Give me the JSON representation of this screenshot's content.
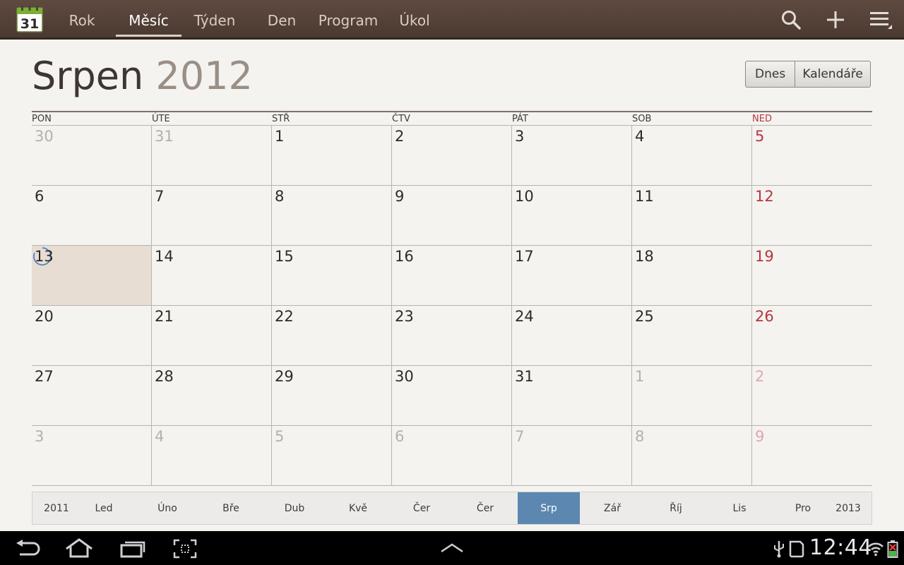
{
  "app": {
    "icon_day": "31",
    "tabs": [
      {
        "label": "Rok",
        "active": false
      },
      {
        "label": "Měsíc",
        "active": true
      },
      {
        "label": "Týden",
        "active": false
      },
      {
        "label": "Den",
        "active": false
      },
      {
        "label": "Program",
        "active": false
      },
      {
        "label": "Úkol",
        "active": false
      }
    ],
    "toolbar_icons": [
      "search-icon",
      "add-icon",
      "menu-icon"
    ]
  },
  "header": {
    "month": "Srpen",
    "year": "2012",
    "today_button": "Dnes",
    "calendars_button": "Kalendáře"
  },
  "weekdays": [
    "PON",
    "ÚTE",
    "STŘ",
    "ČTV",
    "PÁT",
    "SOB",
    "NED"
  ],
  "weeks": [
    [
      {
        "d": "30",
        "o": true
      },
      {
        "d": "31",
        "o": true
      },
      {
        "d": "1"
      },
      {
        "d": "2"
      },
      {
        "d": "3"
      },
      {
        "d": "4"
      },
      {
        "d": "5"
      }
    ],
    [
      {
        "d": "6"
      },
      {
        "d": "7"
      },
      {
        "d": "8"
      },
      {
        "d": "9"
      },
      {
        "d": "10"
      },
      {
        "d": "11"
      },
      {
        "d": "12"
      }
    ],
    [
      {
        "d": "13",
        "today": true
      },
      {
        "d": "14"
      },
      {
        "d": "15"
      },
      {
        "d": "16"
      },
      {
        "d": "17"
      },
      {
        "d": "18"
      },
      {
        "d": "19"
      }
    ],
    [
      {
        "d": "20"
      },
      {
        "d": "21"
      },
      {
        "d": "22"
      },
      {
        "d": "23"
      },
      {
        "d": "24"
      },
      {
        "d": "25"
      },
      {
        "d": "26"
      }
    ],
    [
      {
        "d": "27"
      },
      {
        "d": "28"
      },
      {
        "d": "29"
      },
      {
        "d": "30"
      },
      {
        "d": "31"
      },
      {
        "d": "1",
        "o": true
      },
      {
        "d": "2",
        "o": true
      }
    ],
    [
      {
        "d": "3",
        "o": true
      },
      {
        "d": "4",
        "o": true
      },
      {
        "d": "5",
        "o": true
      },
      {
        "d": "6",
        "o": true
      },
      {
        "d": "7",
        "o": true
      },
      {
        "d": "8",
        "o": true
      },
      {
        "d": "9",
        "o": true
      }
    ]
  ],
  "month_strip": {
    "prev_year": "2011",
    "next_year": "2013",
    "months": [
      "Led",
      "Úno",
      "Bře",
      "Dub",
      "Kvě",
      "Čer",
      "Čer",
      "Srp",
      "Zář",
      "Říj",
      "Lis",
      "Pro"
    ],
    "active_index": 7
  },
  "system_bar": {
    "time": "12:44",
    "icons": [
      "back-icon",
      "home-icon",
      "recent-apps-icon",
      "screenshot-icon",
      "expand-up-icon",
      "usb-icon",
      "sync-icon",
      "wifi-icon",
      "battery-icon"
    ]
  },
  "colors": {
    "sunday": "#b9343e",
    "active_month": "#5b87b1",
    "today_fill": "#e8ddd3",
    "topbar": "#4a3830"
  }
}
